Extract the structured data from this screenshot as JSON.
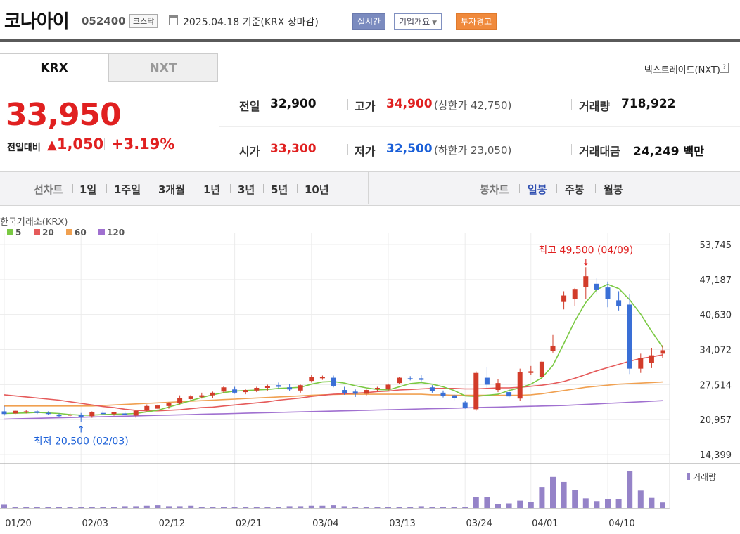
{
  "header": {
    "name": "코나아이",
    "code": "052400",
    "market": "코스닥",
    "date": "2025.04.18",
    "basis": "기준(KRX 장마감)",
    "realtime_btn": "실시간",
    "corp_btn": "기업개요",
    "warn_btn": "투자경고"
  },
  "tabs": {
    "krx": "KRX",
    "nxt": "NXT",
    "nxt_link": "넥스트레이드(NXT)",
    "help": "?"
  },
  "price": {
    "current": "33,950",
    "prev_label": "전일대비",
    "change": "1,050",
    "change_pct": "+3.19%",
    "up_glyph": "▲"
  },
  "stats": {
    "prev_label": "전일",
    "prev": "32,900",
    "high_label": "고가",
    "high": "34,900",
    "upper_limit": "(상한가 42,750)",
    "volume_label": "거래량",
    "volume": "718,922",
    "open_label": "시가",
    "open": "33,300",
    "low_label": "저가",
    "low": "32,500",
    "lower_limit": "(하한가 23,050)",
    "amount_label": "거래대금",
    "amount": "24,249",
    "amount_unit": "백만"
  },
  "toolbar": {
    "line_label": "선차트",
    "ranges": [
      "1일",
      "1주일",
      "3개월",
      "1년",
      "3년",
      "5년",
      "10년"
    ],
    "candle_label": "봉차트",
    "candles": [
      "일봉",
      "주봉",
      "월봉"
    ],
    "active_candle": "일봉"
  },
  "colors": {
    "up": "#d23c2a",
    "down": "#3a6fd6",
    "ma5": "#7ac943",
    "ma20": "#e55a5a",
    "ma60": "#f0a050",
    "ma120": "#a070d0",
    "volume": "#9583c8"
  },
  "chart_data": {
    "type": "candlestick",
    "source_label": "한국거래소(KRX)",
    "legend": [
      "5",
      "20",
      "60",
      "120"
    ],
    "y_ticks": [
      "53,745",
      "47,187",
      "40,630",
      "34,072",
      "27,514",
      "20,957",
      "14,399"
    ],
    "ylim": [
      14399,
      53745
    ],
    "x_ticks": [
      {
        "label": "01/20",
        "i": 0
      },
      {
        "label": "02/03",
        "i": 7
      },
      {
        "label": "02/12",
        "i": 14
      },
      {
        "label": "02/21",
        "i": 21
      },
      {
        "label": "03/04",
        "i": 28
      },
      {
        "label": "03/13",
        "i": 35
      },
      {
        "label": "03/24",
        "i": 42
      },
      {
        "label": "04/01",
        "i": 48
      },
      {
        "label": "04/10",
        "i": 55
      }
    ],
    "annotations": {
      "high": "최고 49,500 (04/09)",
      "low": "최저 20,500 (02/03)"
    },
    "volume_label": "거래량",
    "candles": [
      [
        22500,
        23500,
        21700,
        22000
      ],
      [
        22100,
        22800,
        21800,
        22600
      ],
      [
        22400,
        22800,
        22100,
        22500
      ],
      [
        22500,
        22700,
        22000,
        22200
      ],
      [
        22200,
        22500,
        21800,
        22000
      ],
      [
        21900,
        22100,
        21400,
        21600
      ],
      [
        21700,
        22200,
        21400,
        21900
      ],
      [
        21800,
        22200,
        20500,
        21500
      ],
      [
        21600,
        22500,
        21300,
        22300
      ],
      [
        22200,
        22600,
        21800,
        22100
      ],
      [
        22000,
        22400,
        21700,
        22300
      ],
      [
        22100,
        22500,
        21800,
        21900
      ],
      [
        21700,
        22700,
        21300,
        22600
      ],
      [
        22800,
        23800,
        22600,
        23500
      ],
      [
        23000,
        23800,
        22800,
        23600
      ],
      [
        23500,
        24200,
        23000,
        24000
      ],
      [
        24000,
        25500,
        23800,
        25000
      ],
      [
        24800,
        25600,
        24500,
        25300
      ],
      [
        25200,
        26000,
        24900,
        25500
      ],
      [
        25500,
        26200,
        25000,
        26000
      ],
      [
        26200,
        27200,
        25900,
        27000
      ],
      [
        26600,
        27100,
        25800,
        26000
      ],
      [
        26100,
        26600,
        25700,
        26500
      ],
      [
        26400,
        27100,
        26100,
        26900
      ],
      [
        26900,
        27500,
        26400,
        27200
      ],
      [
        27400,
        27900,
        26800,
        27100
      ],
      [
        27000,
        27600,
        26300,
        26600
      ],
      [
        26400,
        27500,
        26000,
        27400
      ],
      [
        28200,
        29300,
        27900,
        29000
      ],
      [
        28700,
        29200,
        28400,
        28900
      ],
      [
        28800,
        29200,
        27000,
        27300
      ],
      [
        26500,
        27100,
        25600,
        25900
      ],
      [
        26200,
        26600,
        25200,
        25800
      ],
      [
        25800,
        26700,
        25400,
        26500
      ],
      [
        26700,
        27100,
        26200,
        26900
      ],
      [
        26600,
        27700,
        26400,
        27500
      ],
      [
        27800,
        29000,
        27600,
        28800
      ],
      [
        28700,
        29100,
        28300,
        28500
      ],
      [
        28700,
        29300,
        28100,
        28400
      ],
      [
        27000,
        27400,
        26000,
        26300
      ],
      [
        26000,
        26400,
        25100,
        25400
      ],
      [
        25500,
        25700,
        24600,
        25000
      ],
      [
        24200,
        24500,
        23000,
        23200
      ],
      [
        22900,
        30000,
        22600,
        29700
      ],
      [
        28800,
        30800,
        26800,
        27500
      ],
      [
        26500,
        28600,
        26100,
        27800
      ],
      [
        26100,
        26700,
        24900,
        25300
      ],
      [
        24900,
        30500,
        24500,
        29800
      ],
      [
        29700,
        31000,
        29300,
        30000
      ],
      [
        28900,
        32000,
        28700,
        31800
      ],
      [
        33800,
        36800,
        33500,
        34800
      ],
      [
        43000,
        45000,
        41600,
        44200
      ],
      [
        43500,
        45600,
        42300,
        45300
      ],
      [
        45800,
        49500,
        43600,
        47800
      ],
      [
        46400,
        47500,
        44500,
        45200
      ],
      [
        45700,
        46800,
        42000,
        43600
      ],
      [
        43300,
        45000,
        41400,
        42200
      ],
      [
        42500,
        44500,
        29500,
        30500
      ],
      [
        30500,
        33300,
        29700,
        32500
      ],
      [
        31600,
        34400,
        30600,
        33000
      ],
      [
        33300,
        34900,
        32500,
        33950
      ]
    ],
    "ma5": [
      22100,
      22150,
      22200,
      22300,
      22200,
      22100,
      21900,
      21800,
      21800,
      21900,
      21950,
      22000,
      22100,
      22400,
      22700,
      23300,
      23900,
      24500,
      25100,
      25600,
      26000,
      26300,
      26400,
      26500,
      26600,
      26800,
      26900,
      27000,
      27600,
      28000,
      28100,
      27800,
      27300,
      26900,
      26600,
      26500,
      27100,
      27700,
      27900,
      27600,
      27100,
      26400,
      25400,
      25300,
      25500,
      25700,
      26400,
      26900,
      27600,
      28800,
      31100,
      35200,
      39400,
      42900,
      45300,
      46300,
      45500,
      43400,
      40700,
      37500,
      34500
    ],
    "ma20": [
      25600,
      25400,
      25200,
      25000,
      24800,
      24600,
      24300,
      24000,
      23700,
      23400,
      23200,
      22900,
      22700,
      22600,
      22600,
      22700,
      22800,
      23000,
      23200,
      23300,
      23500,
      23700,
      23900,
      24100,
      24300,
      24600,
      24800,
      25000,
      25300,
      25500,
      25700,
      25800,
      25900,
      26000,
      26200,
      26300,
      26500,
      26600,
      26700,
      26800,
      26800,
      26800,
      26700,
      26700,
      26800,
      26900,
      26900,
      27000,
      27200,
      27400,
      27700,
      28100,
      28700,
      29400,
      30100,
      30700,
      31300,
      31900,
      32400,
      32700,
      33100
    ],
    "ma60": [
      23500,
      23500,
      23500,
      23500,
      23500,
      23500,
      23500,
      23500,
      23500,
      23600,
      23700,
      23800,
      23900,
      24000,
      24100,
      24200,
      24300,
      24400,
      24500,
      24600,
      24700,
      24800,
      24900,
      25000,
      25100,
      25200,
      25300,
      25400,
      25500,
      25600,
      25650,
      25700,
      25700,
      25700,
      25700,
      25700,
      25700,
      25700,
      25700,
      25600,
      25600,
      25500,
      25500,
      25500,
      25500,
      25500,
      25500,
      25500,
      25600,
      25800,
      26100,
      26400,
      26700,
      27000,
      27200,
      27400,
      27600,
      27700,
      27800,
      27900,
      28000
    ],
    "ma120": [
      21050,
      21100,
      21150,
      21200,
      21250,
      21300,
      21350,
      21400,
      21450,
      21500,
      21550,
      21600,
      21650,
      21700,
      21750,
      21800,
      21850,
      21900,
      21950,
      22000,
      22050,
      22100,
      22150,
      22200,
      22250,
      22300,
      22350,
      22400,
      22450,
      22500,
      22550,
      22600,
      22650,
      22700,
      22750,
      22800,
      22850,
      22900,
      22950,
      23000,
      23050,
      23100,
      23150,
      23200,
      23250,
      23300,
      23350,
      23400,
      23450,
      23500,
      23550,
      23600,
      23700,
      23800,
      23900,
      24000,
      24100,
      24200,
      24300,
      24400,
      24500
    ],
    "volume": [
      7,
      3,
      3,
      3,
      3,
      3,
      3,
      3,
      3,
      3,
      3,
      4,
      4,
      5,
      6,
      4,
      4,
      5,
      3,
      3,
      3,
      3,
      3,
      3,
      3,
      3,
      4,
      4,
      5,
      5,
      6,
      4,
      3,
      3,
      3,
      3,
      3,
      3,
      4,
      3,
      3,
      3,
      3,
      24,
      24,
      9,
      10,
      16,
      13,
      46,
      68,
      57,
      40,
      21,
      15,
      20,
      20,
      80,
      38,
      22,
      12
    ]
  }
}
